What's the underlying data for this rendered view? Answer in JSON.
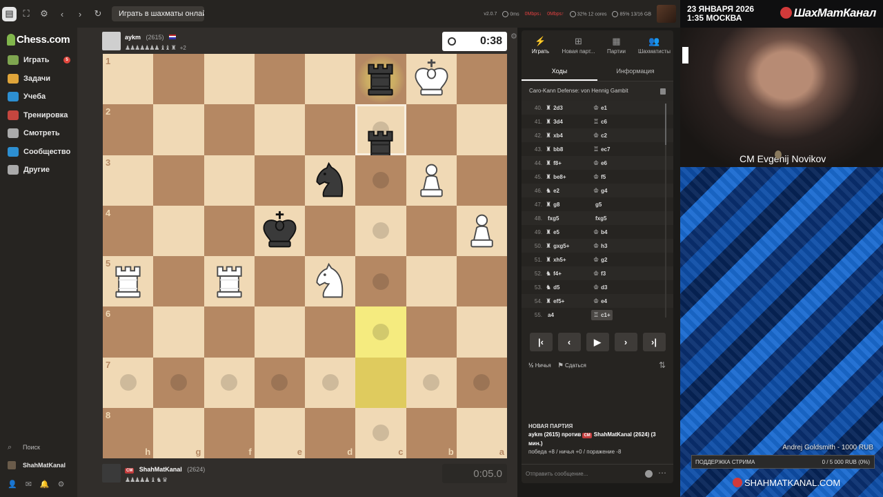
{
  "browser": {
    "tab_title": "Играть в шахматы онлайн ...",
    "status_version": "v2.0.7",
    "status_ping": "0ms",
    "status_down": "0Mbps↓",
    "status_up": "0Mbps↑",
    "status_cpu": "32% 12 cores",
    "status_ram": "85% 13/16 GB"
  },
  "sidebar": {
    "logo": "Chess.com",
    "items": [
      {
        "label": "Играть",
        "badge": "5",
        "color": "#7fa650"
      },
      {
        "label": "Задачи",
        "color": "#e0a53a"
      },
      {
        "label": "Учеба",
        "color": "#2d8fd1"
      },
      {
        "label": "Тренировка",
        "color": "#c4463f"
      },
      {
        "label": "Смотреть",
        "color": "#aaaaaa"
      },
      {
        "label": "Сообщество",
        "color": "#2d8fd1"
      },
      {
        "label": "Другие",
        "color": "#aaaaaa"
      }
    ],
    "search": "Поиск",
    "username": "ShahMatKanal"
  },
  "game": {
    "opponent": {
      "name": "aykm",
      "rating": "(2615)",
      "captured": "♟♟♟♟♟♟♟ ♝♝ ♜",
      "plus": "+2",
      "clock": "0:38"
    },
    "me": {
      "title": "CM",
      "name": "ShahMatKanal",
      "rating": "(2624)",
      "captured": "♟♟♟♟♟ ♝ ♞ ♛",
      "clock": "0:05.0"
    },
    "ranks": [
      "1",
      "2",
      "3",
      "4",
      "5",
      "6",
      "7",
      "8"
    ],
    "files": [
      "h",
      "g",
      "f",
      "e",
      "d",
      "c",
      "b",
      "a"
    ]
  },
  "panel": {
    "tabs": [
      {
        "label": "Играть",
        "icon": "lightning-icon"
      },
      {
        "label": "Новая парт...",
        "icon": "plus-icon"
      },
      {
        "label": "Партии",
        "icon": "board-icon"
      },
      {
        "label": "Шахматисты",
        "icon": "players-icon"
      }
    ],
    "subtabs": [
      "Ходы",
      "Информация"
    ],
    "opening": "Caro-Kann Defense: von Hennig Gambit",
    "moves": [
      {
        "n": "40.",
        "wf": "♜",
        "w": "2d3",
        "bf": "♔",
        "b": "e1"
      },
      {
        "n": "41.",
        "wf": "♜",
        "w": "3d4",
        "bf": "♖",
        "b": "c6"
      },
      {
        "n": "42.",
        "wf": "♜",
        "w": "xb4",
        "bf": "♔",
        "b": "c2"
      },
      {
        "n": "43.",
        "wf": "♜",
        "w": "bb8",
        "bf": "♖",
        "b": "ec7"
      },
      {
        "n": "44.",
        "wf": "♜",
        "w": "f8+",
        "bf": "♔",
        "b": "e6"
      },
      {
        "n": "45.",
        "wf": "♜",
        "w": "be8+",
        "bf": "♔",
        "b": "f5"
      },
      {
        "n": "46.",
        "wf": "♞",
        "w": "e2",
        "bf": "♔",
        "b": "g4"
      },
      {
        "n": "47.",
        "wf": "♜",
        "w": "g8",
        "bf": "",
        "b": "g5"
      },
      {
        "n": "48.",
        "wf": "",
        "w": "fxg5",
        "bf": "",
        "b": "fxg5"
      },
      {
        "n": "49.",
        "wf": "♜",
        "w": "e5",
        "bf": "♔",
        "b": "b4"
      },
      {
        "n": "50.",
        "wf": "♜",
        "w": "gxg5+",
        "bf": "♔",
        "b": "h3"
      },
      {
        "n": "51.",
        "wf": "♜",
        "w": "xh5+",
        "bf": "♔",
        "b": "g2"
      },
      {
        "n": "52.",
        "wf": "♞",
        "w": "f4+",
        "bf": "♔",
        "b": "f3"
      },
      {
        "n": "53.",
        "wf": "♞",
        "w": "d5",
        "bf": "♔",
        "b": "d3"
      },
      {
        "n": "54.",
        "wf": "♜",
        "w": "ef5+",
        "bf": "♔",
        "b": "e4"
      },
      {
        "n": "55.",
        "wf": "",
        "w": "a4",
        "bf": "♖",
        "b": "c1+"
      }
    ],
    "draw": "Ничья",
    "resign": "Сдаться",
    "chat": {
      "title": "НОВАЯ ПАРТИЯ",
      "line_a": "aykm (2615) против",
      "badge": "CM",
      "line_b": "ShahMatKanal (2624) (3 мин.)",
      "line_c": "победа +8 / ничья +0 / поражение -8",
      "placeholder": "Отправить сообщение..."
    }
  },
  "stream": {
    "date": "23 ЯНВАРЯ 2026",
    "time": "1:35 МОСКВА",
    "brand": "ШахМатКанал",
    "streamer": "CM Evgenij Novikov",
    "donor": "Andrej Goldsmith - 1000 RUB",
    "support_label": "ПОДДЕРЖКА СТРИМА",
    "support_value": "0 / 5 000 RUB (0%)",
    "site": "SHAHMATKANAL.COM"
  }
}
